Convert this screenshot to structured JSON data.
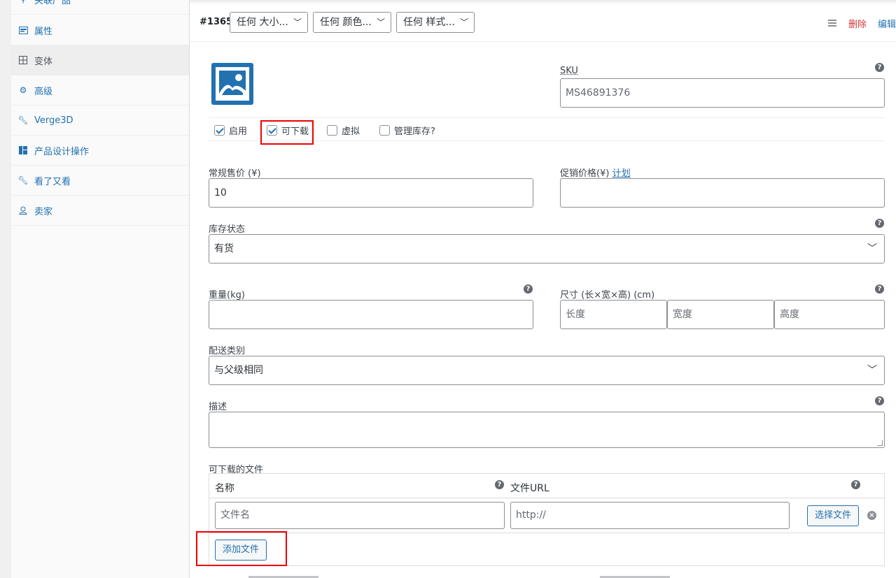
{
  "sidebar": {
    "items": [
      {
        "label": "关联产品",
        "icon": "link-icon"
      },
      {
        "label": "属性",
        "icon": "list-icon"
      },
      {
        "label": "变体",
        "icon": "grid-icon"
      },
      {
        "label": "高级",
        "icon": "gear-icon"
      },
      {
        "label": "Verge3D",
        "icon": "wrench-icon"
      },
      {
        "label": "产品设计操作",
        "icon": "layout-icon"
      },
      {
        "label": "看了又看",
        "icon": "wrench-icon"
      },
      {
        "label": "卖家",
        "icon": "user-icon"
      }
    ]
  },
  "variation": {
    "id": "#1365",
    "selects": [
      "任何 大小...",
      "任何 颜色...",
      "任何 样式..."
    ],
    "delete_label": "删除",
    "edit_label": "编辑"
  },
  "form": {
    "sku_label": "SKU",
    "sku_value": "MS46891376",
    "options": {
      "enabled": "启用",
      "downloadable": "可下载",
      "virtual": "虚拟",
      "manage_stock": "管理库存?"
    },
    "regular_price_label": "常规售价 (¥)",
    "regular_price_value": "10",
    "sale_price_label": "促销价格(¥)",
    "schedule_link": "计划",
    "stock_status_label": "库存状态",
    "stock_status_value": "有货",
    "weight_label": "重量(kg)",
    "dimensions_label": "尺寸 (长×宽×高) (cm)",
    "length_placeholder": "长度",
    "width_placeholder": "宽度",
    "height_placeholder": "高度",
    "shipping_class_label": "配送类别",
    "shipping_class_value": "与父级相同",
    "description_label": "描述"
  },
  "downloads": {
    "section_label": "可下载的文件",
    "name_header": "名称",
    "url_header": "文件URL",
    "name_placeholder": "文件名",
    "url_placeholder": "http://",
    "choose_file_button": "选择文件",
    "add_file_button": "添加文件"
  },
  "colors": {
    "accent": "#2271b1",
    "danger": "#d63638",
    "highlight_box": "#ee0000"
  }
}
